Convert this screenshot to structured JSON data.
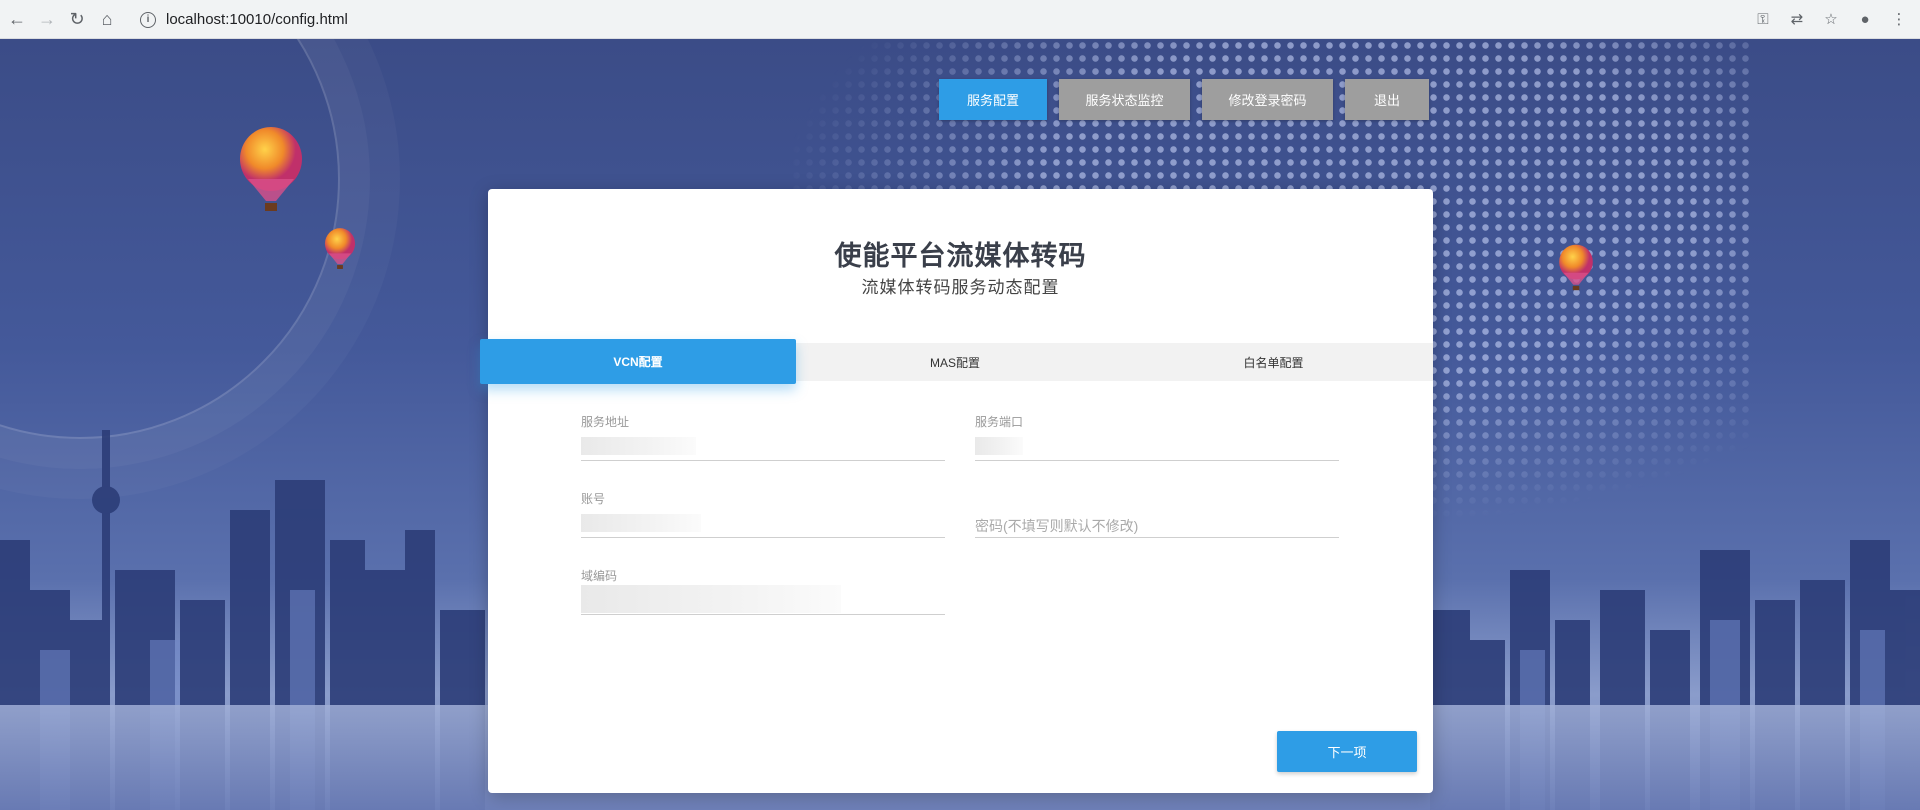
{
  "browser": {
    "url": "localhost:10010/config.html"
  },
  "topnav": {
    "items": [
      {
        "label": "服务配置",
        "active": true
      },
      {
        "label": "服务状态监控",
        "active": false
      },
      {
        "label": "修改登录密码",
        "active": false
      },
      {
        "label": "退出",
        "active": false
      }
    ]
  },
  "card": {
    "title": "使能平台流媒体转码",
    "subtitle": "流媒体转码服务动态配置",
    "tabs": [
      {
        "label": "VCN配置",
        "active": true
      },
      {
        "label": "MAS配置",
        "active": false
      },
      {
        "label": "白名单配置",
        "active": false
      }
    ],
    "fields": {
      "service_address": {
        "label": "服务地址",
        "value": ""
      },
      "service_port": {
        "label": "服务端口",
        "value": ""
      },
      "account": {
        "label": "账号",
        "value": ""
      },
      "password": {
        "label": "",
        "placeholder": "密码(不填写则默认不修改)"
      },
      "domain_code": {
        "label": "域编码",
        "value": ""
      }
    },
    "next_label": "下一项"
  },
  "colors": {
    "accent": "#2e9de6",
    "inactive_button": "#9e9e9e"
  }
}
